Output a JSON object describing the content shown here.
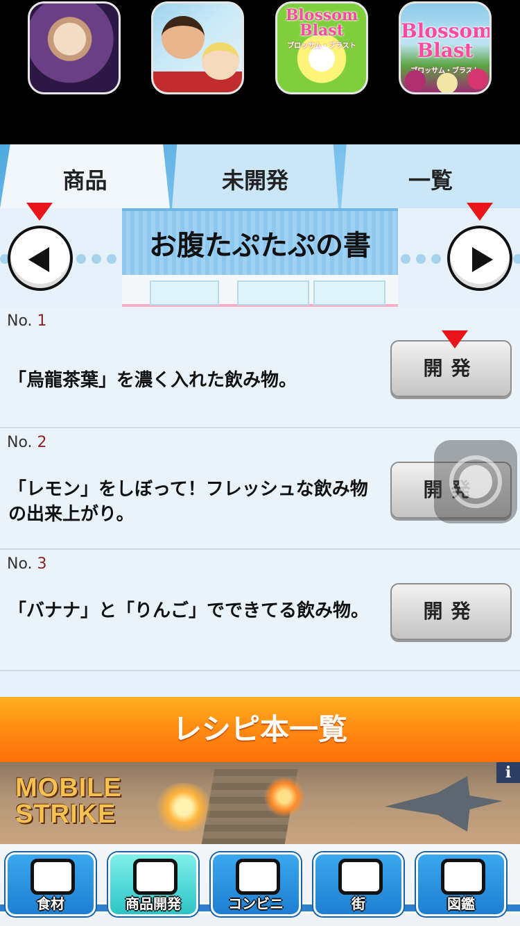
{
  "promo": {
    "apps": [
      {
        "name": "character-portrait-app",
        "label": ""
      },
      {
        "name": "action-heroes-app",
        "label": ""
      },
      {
        "name": "blossom-blast-burst-app",
        "title": "Blossom Blast",
        "subtitle": "ブロッサム・ブラスト"
      },
      {
        "name": "blossom-blast-app",
        "title": "Blossom Blast",
        "subtitle": "ブロッサム・ブラスト"
      }
    ]
  },
  "tabs": [
    {
      "label": "商品",
      "selected": true
    },
    {
      "label": "未開発",
      "selected": false
    },
    {
      "label": "一覧",
      "selected": false
    }
  ],
  "book": {
    "title": "お腹たぷたぷの書"
  },
  "recipes": [
    {
      "no_prefix": "No.",
      "no": "1",
      "description": "「烏龍茶葉」を濃く入れた飲み物。",
      "button": "開発"
    },
    {
      "no_prefix": "No.",
      "no": "2",
      "description": "「レモン」をしぼって！フレッシュな飲み物の出来上がり。",
      "button": "開発"
    },
    {
      "no_prefix": "No.",
      "no": "3",
      "description": "「バナナ」と「りんご」でできてる飲み物。",
      "button": "開発"
    }
  ],
  "recipe_list_button": "レシピ本一覧",
  "ad": {
    "logo_line1": "MOBILE",
    "logo_line2": "STRIKE",
    "info": "i"
  },
  "nav": [
    {
      "label": "食材",
      "icon": "fish-vegetable-icon",
      "active": false
    },
    {
      "label": "商品開発",
      "icon": "roll-onigiri-icon",
      "active": true
    },
    {
      "label": "コンビニ",
      "icon": "store-icon",
      "active": false
    },
    {
      "label": "街",
      "icon": "buildings-icon",
      "active": false
    },
    {
      "label": "図鑑",
      "icon": "book-icon",
      "active": false
    }
  ],
  "colors": {
    "accent_orange": "#ff8a12",
    "tab_blue": "#7fc4ee",
    "marker_red": "#e8161b",
    "nav_blue": "#1e7fd1"
  }
}
